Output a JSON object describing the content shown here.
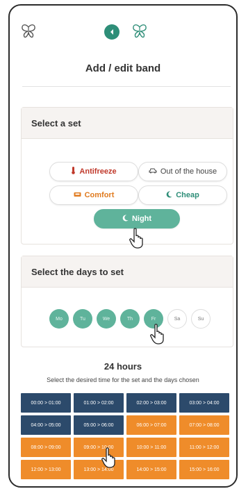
{
  "header": {
    "title": "Add / edit band"
  },
  "set_panel": {
    "heading": "Select a set",
    "sets": [
      {
        "label": "Antifreeze",
        "icon": "thermometer-icon"
      },
      {
        "label": "Out of the house",
        "icon": "car-icon"
      },
      {
        "label": "Comfort",
        "icon": "sofa-icon"
      },
      {
        "label": "Cheap",
        "icon": "moon-icon"
      },
      {
        "label": "Night",
        "icon": "moon-icon",
        "selected": true
      }
    ]
  },
  "days_panel": {
    "heading": "Select the days to set",
    "days": [
      {
        "label": "Mo",
        "selected": true
      },
      {
        "label": "Tu",
        "selected": true
      },
      {
        "label": "We",
        "selected": true
      },
      {
        "label": "Th",
        "selected": true
      },
      {
        "label": "Fr",
        "selected": true
      },
      {
        "label": "Sa",
        "selected": false
      },
      {
        "label": "Su",
        "selected": false
      }
    ]
  },
  "hours": {
    "title": "24 hours",
    "subtitle": "Select the desired time for the set and the days chosen",
    "slots": [
      {
        "label": "00:00 > 01:00",
        "color": "navy"
      },
      {
        "label": "01:00 > 02:00",
        "color": "navy"
      },
      {
        "label": "02:00 > 03:00",
        "color": "navy"
      },
      {
        "label": "03:00 > 04:00",
        "color": "navy"
      },
      {
        "label": "04:00 > 05:00",
        "color": "navy"
      },
      {
        "label": "05:00 > 06:00",
        "color": "navy"
      },
      {
        "label": "06:00 > 07:00",
        "color": "orange"
      },
      {
        "label": "07:00 > 08:00",
        "color": "orange"
      },
      {
        "label": "08:00 > 09:00",
        "color": "orange"
      },
      {
        "label": "09:00 > 10:00",
        "color": "orange"
      },
      {
        "label": "10:00 > 11:00",
        "color": "orange"
      },
      {
        "label": "11:00 > 12:00",
        "color": "orange"
      },
      {
        "label": "12:00 > 13:00",
        "color": "orange"
      },
      {
        "label": "13:00 > 14:00",
        "color": "orange"
      },
      {
        "label": "14:00 > 15:00",
        "color": "orange"
      },
      {
        "label": "15:00 > 16:00",
        "color": "orange"
      }
    ]
  },
  "colors": {
    "accent": "#2e8e78",
    "selected": "#5fb39b",
    "navy": "#2c4a6b",
    "orange": "#ef8c2a"
  }
}
